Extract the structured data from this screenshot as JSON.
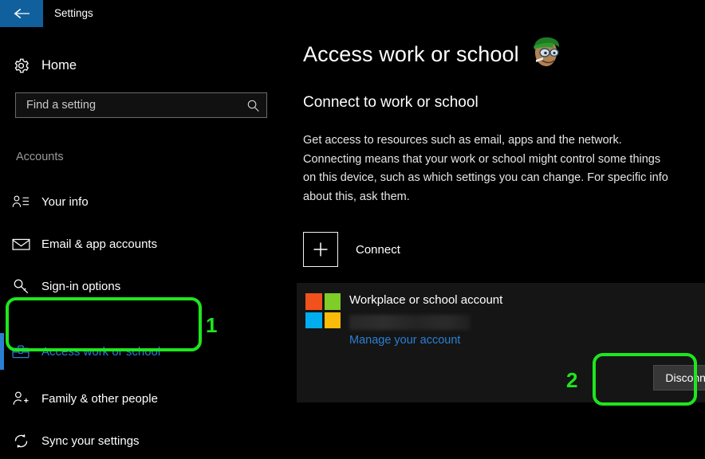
{
  "window": {
    "title": "Settings",
    "back_icon": "back-arrow-icon",
    "accent_blue": "#10609e"
  },
  "sidebar": {
    "home": {
      "label": "Home",
      "icon": "gear-icon"
    },
    "search": {
      "value": "",
      "placeholder": "Find a setting",
      "icon": "search-icon"
    },
    "section_heading": "Accounts",
    "items": [
      {
        "label": "Your info",
        "icon": "user-info-icon",
        "selected": false
      },
      {
        "label": "Email & app accounts",
        "icon": "envelope-icon",
        "selected": false
      },
      {
        "label": "Sign-in options",
        "icon": "key-icon",
        "selected": false
      },
      {
        "label": "Access work or school",
        "icon": "briefcase-icon",
        "selected": true
      },
      {
        "label": "Family & other people",
        "icon": "user-add-icon",
        "selected": false
      },
      {
        "label": "Sync your settings",
        "icon": "sync-icon",
        "selected": false
      }
    ],
    "selected_color": "#2a7fd4"
  },
  "main": {
    "page_title": "Access work or school",
    "subsection_title": "Connect to work or school",
    "description": "Get access to resources such as email, apps and the network. Connecting means that your work or school might control some things on this device, such as which settings you can change. For specific info about this, ask them.",
    "connect": {
      "label": "Connect",
      "icon": "plus-icon"
    },
    "account_card": {
      "logo_icon": "microsoft-logo-icon",
      "logo_colors": [
        "#f1511b",
        "#80cc28",
        "#00adef",
        "#fbbc09"
      ],
      "name": "Workplace or school account",
      "email_redacted": true,
      "manage_link": "Manage your account",
      "disconnect_label": "Disconnect"
    }
  },
  "annotations": {
    "color": "#1ee61e",
    "markers": [
      {
        "number": "1",
        "target": "sidebar-item-access-work-or-school"
      },
      {
        "number": "2",
        "target": "disconnect-button"
      }
    ]
  },
  "watermark": {
    "icon": "cartoon-character-watermark"
  }
}
